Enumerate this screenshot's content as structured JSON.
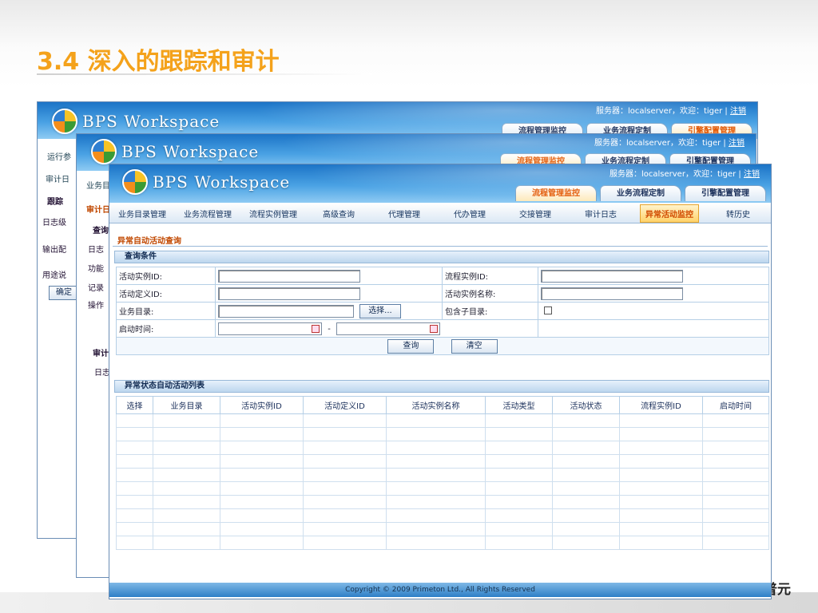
{
  "slide": {
    "title": "3.4 深入的跟踪和审计",
    "brand": "普元"
  },
  "app": {
    "logo_text": "BPS Workspace",
    "server_label": "服务器：localserver，欢迎：tiger |",
    "logout_label": "注销"
  },
  "top_tabs": [
    "流程管理监控",
    "业务流程定制",
    "引擎配置管理"
  ],
  "back1": {
    "side_label_1": "运行参",
    "tree_label": "审计日",
    "rows": [
      "跟踪",
      "日志级",
      "输出配",
      "用途说"
    ],
    "btn": "确定"
  },
  "back2": {
    "menu_label": "业务目",
    "section": "审计日",
    "rows": [
      "查询",
      "日志",
      "功能",
      "记录",
      "操作"
    ],
    "sub_panel": "审计",
    "sub_row": "日志"
  },
  "menu": {
    "items": [
      "业务目录管理",
      "业务流程管理",
      "流程实例管理",
      "高级查询",
      "代理管理",
      "代办管理",
      "交接管理",
      "审计日志",
      "异常活动监控",
      "转历史"
    ],
    "active": "异常活动监控"
  },
  "page": {
    "section_title": "异常自动活动查询",
    "query_panel": "查询条件",
    "fields": {
      "activity_instance_id": "活动实例ID:",
      "process_instance_id": "流程实例ID:",
      "activity_def_id": "活动定义ID:",
      "activity_instance_name": "活动实例名称:",
      "business_catalog": "业务目录:",
      "include_sub_catalog": "包含子目录:",
      "start_time": "启动时间:",
      "date_separator": "-"
    },
    "buttons": {
      "select": "选择...",
      "query": "查询",
      "clear": "清空"
    },
    "list_panel": "异常状态自动活动列表",
    "columns": [
      "选择",
      "业务目录",
      "活动实例ID",
      "活动定义ID",
      "活动实例名称",
      "活动类型",
      "活动状态",
      "流程实例ID",
      "启动时间"
    ]
  },
  "footer": {
    "copyright": "Copyright © 2009 Primeton Ltd., All Rights Reserved"
  }
}
